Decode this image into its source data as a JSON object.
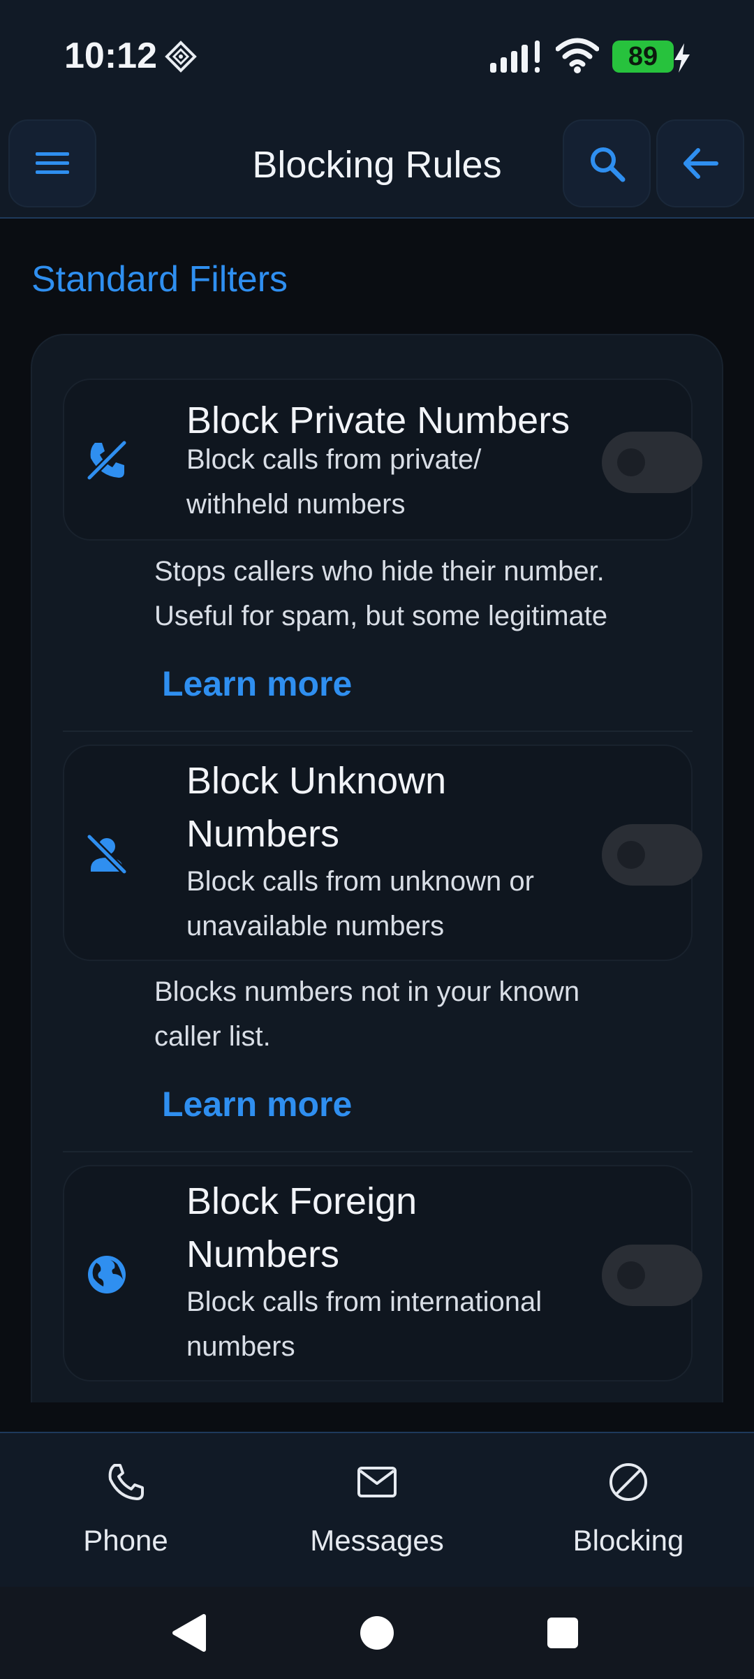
{
  "status_bar": {
    "time": "10:12",
    "battery": "89"
  },
  "app_bar": {
    "title": "Blocking Rules"
  },
  "section": {
    "title": "Standard Filters"
  },
  "rules": [
    {
      "title_lines": [
        "Block Private Numbers"
      ],
      "subtitle_lines": [
        "Block calls from private/",
        "withheld numbers"
      ],
      "description_lines": [
        "Stops callers who hide their number.",
        "Useful for spam, but some legitimate"
      ],
      "learn_more": "Learn more",
      "enabled": false,
      "icon": "phone-off-icon"
    },
    {
      "title_lines": [
        "Block Unknown",
        "Numbers"
      ],
      "subtitle_lines": [
        "Block calls from unknown or",
        "unavailable numbers"
      ],
      "description_lines": [
        "Blocks numbers not in your known",
        "caller list."
      ],
      "learn_more": "Learn more",
      "enabled": false,
      "icon": "person-off-icon"
    },
    {
      "title_lines": [
        "Block Foreign",
        "Numbers"
      ],
      "subtitle_lines": [
        "Block calls from international",
        "numbers"
      ],
      "enabled": false,
      "icon": "globe-icon"
    }
  ],
  "bottom_nav": [
    {
      "label": "Phone",
      "icon": "phone-icon"
    },
    {
      "label": "Messages",
      "icon": "mail-icon"
    },
    {
      "label": "Blocking",
      "icon": "block-icon"
    }
  ],
  "colors": {
    "accent": "#2f8ff0",
    "background": "#0a0d12",
    "surface": "#111923",
    "battery": "#27c23d"
  }
}
